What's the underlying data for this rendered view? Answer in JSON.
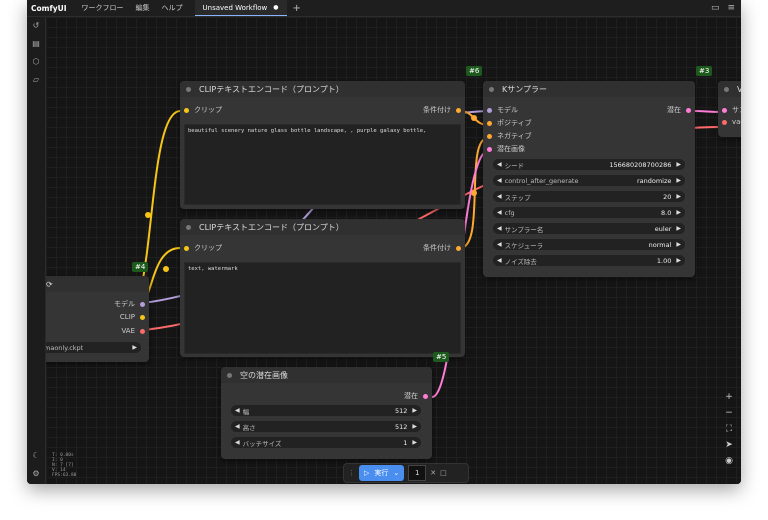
{
  "menubar": {
    "brand": "ComfyUI",
    "menus": [
      "ワークフロー",
      "編集",
      "ヘルプ"
    ],
    "tab_title": "Unsaved Workflow",
    "tab_modified": "●",
    "new_tab": "+"
  },
  "nodes": {
    "clip_top": {
      "badge": "#6",
      "title": "CLIPテキストエンコード（プロンプト）",
      "input": "クリップ",
      "output": "条件付け",
      "text": "beautiful scenery nature glass bottle landscape, , purple galaxy bottle,"
    },
    "clip_bottom": {
      "title": "CLIPテキストエンコード（プロンプト）",
      "input": "クリップ",
      "output": "条件付け",
      "text": "text, watermark"
    },
    "ksampler": {
      "badge": "#3",
      "title": "Kサンプラー",
      "inputs": [
        "モデル",
        "ポジティブ",
        "ネガティブ",
        "潜在画像"
      ],
      "output": "潜在",
      "widgets": [
        {
          "label": "シード",
          "value": "156680208700286"
        },
        {
          "label": "control_after_generate",
          "value": "randomize"
        },
        {
          "label": "ステップ",
          "value": "20"
        },
        {
          "label": "cfg",
          "value": "8.0"
        },
        {
          "label": "サンプラー名",
          "value": "euler"
        },
        {
          "label": "スケジューラ",
          "value": "normal"
        },
        {
          "label": "ノイズ除去",
          "value": "1.00"
        }
      ]
    },
    "checkpoint": {
      "badge": "#4",
      "outputs": [
        "モデル",
        "CLIP",
        "VAE"
      ],
      "ckpt": "maonly.ckpt"
    },
    "latent": {
      "badge": "#5",
      "title": "空の潜在画像",
      "output": "潜在",
      "widgets": [
        {
          "label": "幅",
          "value": "512"
        },
        {
          "label": "高さ",
          "value": "512"
        },
        {
          "label": "バッチサイズ",
          "value": "1"
        }
      ]
    },
    "vae": {
      "title": "VA",
      "inputs": [
        "サンプ",
        "vae"
      ]
    }
  },
  "stats": [
    "T: 0.00s",
    "I: 0",
    "N: 7 [7]",
    "V: 14",
    "FPS:63.80"
  ],
  "runbar": {
    "run_label": "実行",
    "count": "1"
  },
  "colors": {
    "clip": "#f5c518",
    "model": "#b39ddb",
    "vae": "#ff6b6b",
    "latent": "#ff7dd6",
    "conditioning": "#ffa931",
    "accent": "#4a8ef0"
  }
}
